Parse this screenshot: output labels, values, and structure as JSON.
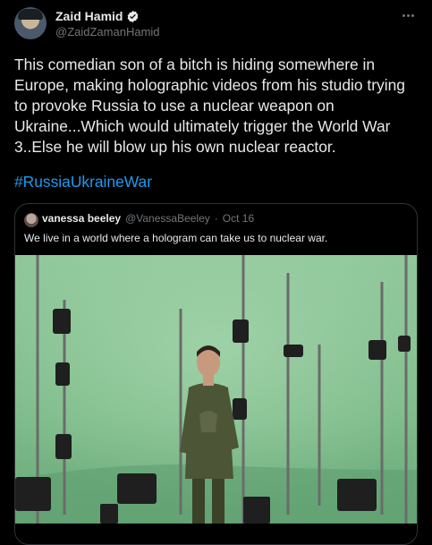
{
  "author": {
    "display_name": "Zaid Hamid",
    "handle": "@ZaidZamanHamid",
    "verified": true
  },
  "tweet": {
    "text": "This comedian son of a bitch is hiding somewhere in Europe, making holographic videos from his studio trying to provoke Russia to use a nuclear weapon on Ukraine...Which would ultimately trigger the World War 3..Else he will blow up his own nuclear reactor.",
    "hashtag": "#RussiaUkraineWar"
  },
  "quoted_tweet": {
    "display_name": "vanessa beeley",
    "handle": "@VanessaBeeley",
    "separator": "·",
    "date": "Oct 16",
    "text": "We live in a world where a hologram can take us to nuclear war."
  },
  "colors": {
    "background": "#000000",
    "text": "#e7e9ea",
    "muted": "#71767b",
    "link": "#1d9bf0",
    "border": "#2f3336",
    "green_screen": "#7fbf8a"
  },
  "icons": [
    "verified-badge-icon",
    "more-options-icon"
  ]
}
